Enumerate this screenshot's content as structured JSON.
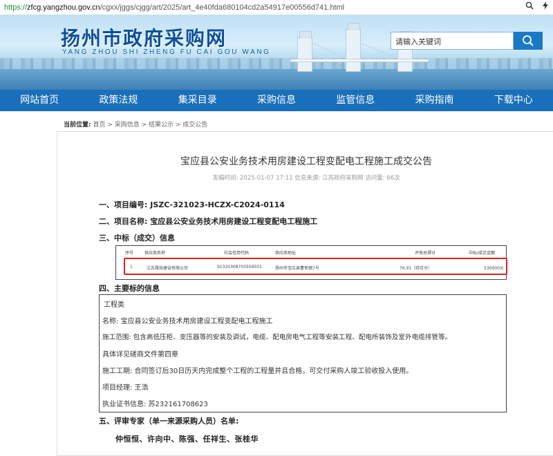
{
  "address": {
    "scheme": "https://",
    "host": "zfcg.yangzhou.gov.cn",
    "path": "/cgxx/jggs/cjgg/art/2025/art_4e40fda680104cd2a54917e00556d741.html",
    "icons": [
      "search-icon",
      "lightning-icon"
    ]
  },
  "site": {
    "title": "扬州市政府采购网",
    "subtitle": "YANG ZHOU SHI ZHENG FU CAI GOU WANG",
    "search_placeholder": "请输入关键词"
  },
  "nav": [
    "网站首页",
    "政策法规",
    "集采目录",
    "采购信息",
    "监管信息",
    "采购指南",
    "下载中心"
  ],
  "breadcrumb": {
    "label": "当前位置:",
    "path": "首页 > 采购信息 > 结果公示 > 成交公告"
  },
  "article": {
    "title": "宝应县公安业务技术用房建设工程变配电工程施工成交公告",
    "meta": "发稿时间: 2025-01-07 17:11   信息来源: 江苏政府采购网   访问量: 66次",
    "s1": "一、项目编号: JSZC-321023-HCZX-C2024-0114",
    "s2": "二、项目名称: 宝应县公安业务技术用房建设工程变配电工程施工",
    "s3": "三、中标（成交）信息",
    "s4": "四、主要标的信息",
    "s5": "五、评审专家（单一来源采购人员）名单:"
  },
  "award_table": {
    "headers": [
      "序号",
      "供应商名称",
      "社会信用代码",
      "供应商地址",
      "评审总得分",
      "中标/成交金额"
    ],
    "rows": [
      [
        "1",
        "江苏晟技建设有限公司",
        "913203087035S9501",
        "扬州市宝应县曹甸镇7号",
        "76.91（综合分）",
        "530000元"
      ]
    ]
  },
  "info_box": {
    "category": "工程类",
    "name": "名称: 宝应县公安业务技术用房建设工程变配电工程施工",
    "scope": "施工范围: 包含高低压柜、变压器等的安装及调试，电缆、配电房电气工程等安装工程、配电所装饰及室外电缆排管等。",
    "detail": "具体详见磋商文件第四章",
    "period": "施工工期: 合同签订后30日历天内完成整个工程的工程量并且合格，可交付采购人竣工验收投入使用。",
    "manager": "项目经理: 王浩",
    "certificate": "执业证书信息: 苏232161708623"
  },
  "experts": "仲恒恒、许向中、陈强、任祥生、张桂华"
}
